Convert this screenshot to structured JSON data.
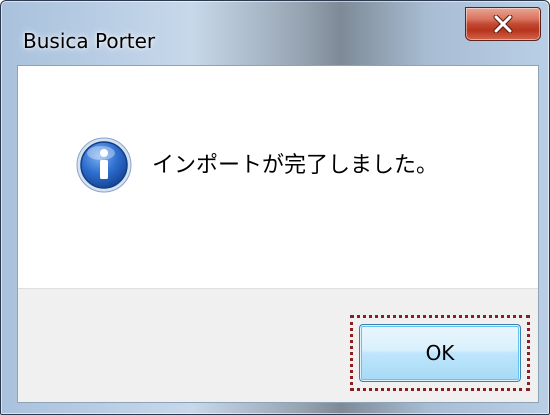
{
  "window": {
    "title": "Busica Porter"
  },
  "titlebar": {
    "close_icon": "close-x-icon"
  },
  "message": {
    "icon": "information-icon",
    "text": "インポートが完了しました。"
  },
  "buttons": {
    "ok_label": "OK"
  },
  "colors": {
    "focus_outline": "#8b1e1e",
    "close_button": "#c24a32",
    "info_icon_blue": "#1f5fb8",
    "ok_button_border": "#3c7fb1"
  }
}
